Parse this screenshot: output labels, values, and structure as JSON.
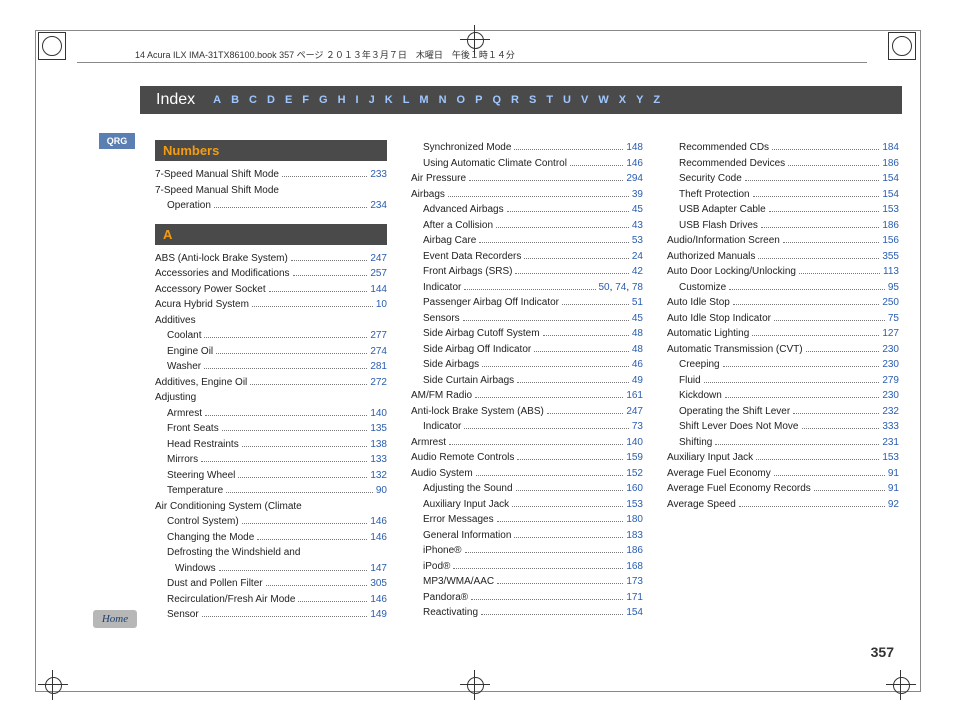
{
  "header_info": "14 Acura ILX IMA-31TX86100.book  357 ページ  ２０１３年３月７日　木曜日　午後１時１４分",
  "index_title": "Index",
  "index_letters": [
    "A",
    "B",
    "C",
    "D",
    "E",
    "F",
    "G",
    "H",
    "I",
    "J",
    "K",
    "L",
    "M",
    "N",
    "O",
    "P",
    "Q",
    "R",
    "S",
    "T",
    "U",
    "V",
    "W",
    "X",
    "Y",
    "Z"
  ],
  "qrg": "QRG",
  "home": "Home",
  "page_number": "357",
  "sections": {
    "numbers_header": "Numbers",
    "a_header": "A"
  },
  "col1": [
    {
      "t": "7-Speed Manual Shift Mode",
      "p": "233"
    },
    {
      "t": "7-Speed Manual Shift Mode",
      "nolink": true
    },
    {
      "t": "Operation",
      "p": "234",
      "sub": true
    }
  ],
  "col1a": [
    {
      "t": "ABS (Anti-lock Brake System)",
      "p": "247"
    },
    {
      "t": "Accessories and Modifications",
      "p": "257"
    },
    {
      "t": "Accessory Power Socket",
      "p": "144"
    },
    {
      "t": "Acura Hybrid System",
      "p": "10"
    },
    {
      "t": "Additives",
      "nolink": true
    },
    {
      "t": "Coolant",
      "p": "277",
      "sub": true
    },
    {
      "t": "Engine Oil",
      "p": "274",
      "sub": true
    },
    {
      "t": "Washer",
      "p": "281",
      "sub": true
    },
    {
      "t": "Additives, Engine Oil",
      "p": "272"
    },
    {
      "t": "Adjusting",
      "nolink": true
    },
    {
      "t": "Armrest",
      "p": "140",
      "sub": true
    },
    {
      "t": "Front Seats",
      "p": "135",
      "sub": true
    },
    {
      "t": "Head Restraints",
      "p": "138",
      "sub": true
    },
    {
      "t": "Mirrors",
      "p": "133",
      "sub": true
    },
    {
      "t": "Steering Wheel",
      "p": "132",
      "sub": true
    },
    {
      "t": "Temperature",
      "p": "90",
      "sub": true
    },
    {
      "t": "Air Conditioning System (Climate",
      "nolink": true
    },
    {
      "t": "Control System)",
      "p": "146",
      "sub": true
    },
    {
      "t": "Changing the Mode",
      "p": "146",
      "sub": true
    },
    {
      "t": "Defrosting the Windshield and",
      "nolink": true,
      "sub": true
    },
    {
      "t": "Windows",
      "p": "147",
      "sub": true,
      "sub2": true
    },
    {
      "t": "Dust and Pollen Filter",
      "p": "305",
      "sub": true
    },
    {
      "t": "Recirculation/Fresh Air Mode",
      "p": "146",
      "sub": true
    },
    {
      "t": "Sensor",
      "p": "149",
      "sub": true
    }
  ],
  "col2": [
    {
      "t": "Synchronized Mode",
      "p": "148",
      "sub": true
    },
    {
      "t": "Using Automatic Climate Control",
      "p": "146",
      "sub": true
    },
    {
      "t": "Air Pressure",
      "p": "294"
    },
    {
      "t": "Airbags",
      "p": "39"
    },
    {
      "t": "Advanced Airbags",
      "p": "45",
      "sub": true
    },
    {
      "t": "After a Collision",
      "p": "43",
      "sub": true
    },
    {
      "t": "Airbag Care",
      "p": "53",
      "sub": true
    },
    {
      "t": "Event Data Recorders",
      "p": "24",
      "sub": true
    },
    {
      "t": "Front Airbags (SRS)",
      "p": "42",
      "sub": true
    },
    {
      "t": "Indicator",
      "p": "50, 74, 78",
      "sub": true,
      "multi": true
    },
    {
      "t": "Passenger Airbag Off Indicator",
      "p": "51",
      "sub": true
    },
    {
      "t": "Sensors",
      "p": "45",
      "sub": true
    },
    {
      "t": "Side Airbag Cutoff System",
      "p": "48",
      "sub": true
    },
    {
      "t": "Side Airbag Off Indicator",
      "p": "48",
      "sub": true
    },
    {
      "t": "Side Airbags",
      "p": "46",
      "sub": true
    },
    {
      "t": "Side Curtain Airbags",
      "p": "49",
      "sub": true
    },
    {
      "t": "AM/FM Radio",
      "p": "161"
    },
    {
      "t": "Anti-lock Brake System (ABS)",
      "p": "247"
    },
    {
      "t": "Indicator",
      "p": "73",
      "sub": true
    },
    {
      "t": "Armrest",
      "p": "140"
    },
    {
      "t": "Audio Remote Controls",
      "p": "159"
    },
    {
      "t": "Audio System",
      "p": "152"
    },
    {
      "t": "Adjusting the Sound",
      "p": "160",
      "sub": true
    },
    {
      "t": "Auxiliary Input Jack",
      "p": "153",
      "sub": true
    },
    {
      "t": "Error Messages",
      "p": "180",
      "sub": true
    },
    {
      "t": "General Information",
      "p": "183",
      "sub": true
    },
    {
      "t": "iPhone®",
      "p": "186",
      "sub": true
    },
    {
      "t": "iPod®",
      "p": "168",
      "sub": true
    },
    {
      "t": "MP3/WMA/AAC",
      "p": "173",
      "sub": true
    },
    {
      "t": "Pandora®",
      "p": "171",
      "sub": true
    },
    {
      "t": "Reactivating",
      "p": "154",
      "sub": true
    }
  ],
  "col3": [
    {
      "t": "Recommended CDs",
      "p": "184",
      "sub": true
    },
    {
      "t": "Recommended Devices",
      "p": "186",
      "sub": true
    },
    {
      "t": "Security Code",
      "p": "154",
      "sub": true
    },
    {
      "t": "Theft Protection",
      "p": "154",
      "sub": true
    },
    {
      "t": "USB Adapter Cable",
      "p": "153",
      "sub": true
    },
    {
      "t": "USB Flash Drives",
      "p": "186",
      "sub": true
    },
    {
      "t": "Audio/Information Screen",
      "p": "156"
    },
    {
      "t": "Authorized Manuals",
      "p": "355"
    },
    {
      "t": "Auto Door Locking/Unlocking",
      "p": "113"
    },
    {
      "t": "Customize",
      "p": "95",
      "sub": true
    },
    {
      "t": "Auto Idle Stop",
      "p": "250"
    },
    {
      "t": "Auto Idle Stop Indicator",
      "p": "75"
    },
    {
      "t": "Automatic Lighting",
      "p": "127"
    },
    {
      "t": "Automatic Transmission (CVT)",
      "p": "230"
    },
    {
      "t": "Creeping",
      "p": "230",
      "sub": true
    },
    {
      "t": "Fluid",
      "p": "279",
      "sub": true
    },
    {
      "t": "Kickdown",
      "p": "230",
      "sub": true
    },
    {
      "t": "Operating the Shift Lever",
      "p": "232",
      "sub": true
    },
    {
      "t": "Shift Lever Does Not Move",
      "p": "333",
      "sub": true
    },
    {
      "t": "Shifting",
      "p": "231",
      "sub": true
    },
    {
      "t": "Auxiliary Input Jack",
      "p": "153"
    },
    {
      "t": "Average Fuel Economy",
      "p": "91"
    },
    {
      "t": "Average Fuel Economy Records",
      "p": "91"
    },
    {
      "t": "Average Speed",
      "p": "92"
    }
  ]
}
